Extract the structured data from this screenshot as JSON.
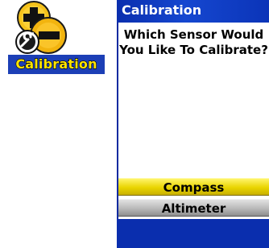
{
  "app_tile": {
    "label": "Calibration",
    "icon": "calibration-plus-minus-icon"
  },
  "dialog": {
    "title": "Calibration",
    "prompt": "Which Sensor Would\nYou Like To Calibrate?",
    "options": [
      {
        "label": "Compass",
        "selected": true
      },
      {
        "label": "Altimeter",
        "selected": false
      }
    ]
  },
  "colors": {
    "titlebar_blue": "#0a2eae",
    "label_bg": "#1c3fb6",
    "label_text": "#ffe400",
    "selected_yellow": "#e9d400",
    "unselected_gray": "#b9b9b9"
  }
}
